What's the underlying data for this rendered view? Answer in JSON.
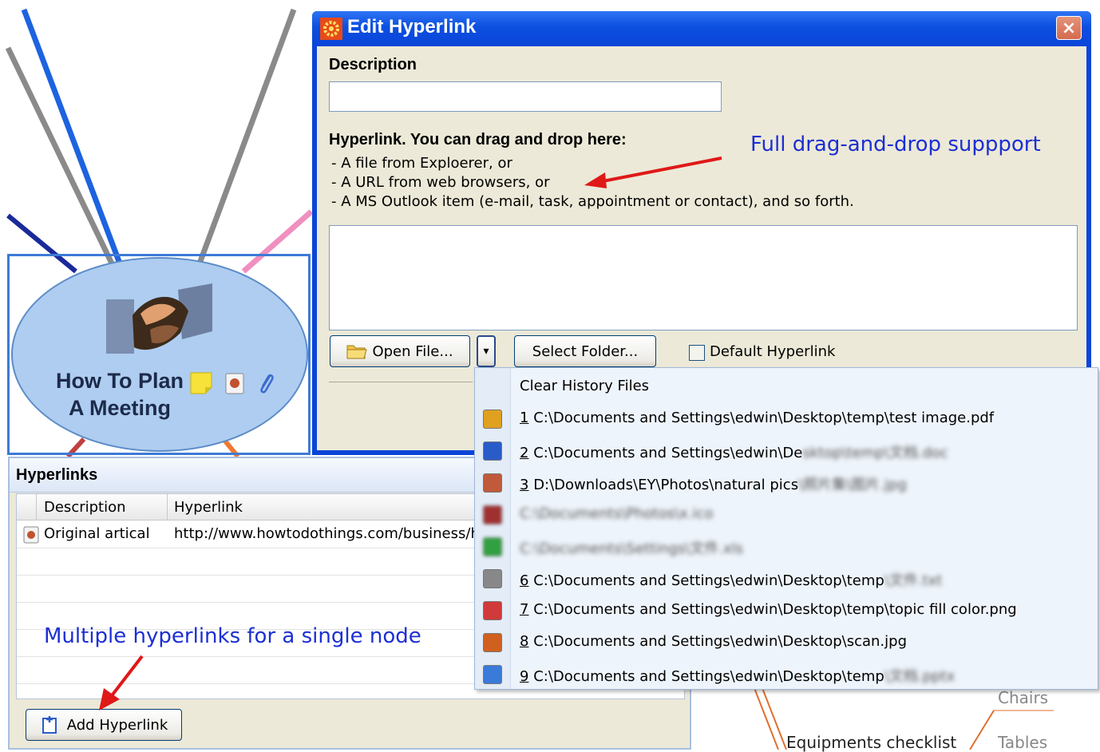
{
  "mindmap": {
    "central_node": {
      "line1": "How To Plan",
      "line2": "A Meeting",
      "icons": [
        "handshake-icon",
        "note-icon",
        "hyperlink-icon",
        "attachment-icon"
      ]
    },
    "branch_labels": [
      "Chairs",
      "Equipments checklist",
      "Tables"
    ]
  },
  "dialog": {
    "title": "Edit Hyperlink",
    "close_glyph": "×",
    "description_label": "Description",
    "description_value": "",
    "hyperlink_label": "Hyperlink. You can drag and drop here:",
    "drop_hints": [
      "- A file from Exploerer, or",
      "- A URL from web browsers, or",
      "- A MS Outlook item (e-mail, task, appointment or contact), and so forth."
    ],
    "hyperlink_value": "",
    "open_file_button": "Open File...",
    "dropdown_glyph": "▾",
    "select_folder_button": "Select Folder...",
    "default_hyperlink_label": "Default Hyperlink",
    "default_hyperlink_checked": false
  },
  "history_menu": {
    "clear_label": "Clear History Files",
    "items": [
      {
        "num": "1",
        "path": "C:\\Documents and Settings\\edwin\\Desktop\\temp\\test image.pdf",
        "hidden": "",
        "icon": "pdf-icon",
        "color": "#e0a020"
      },
      {
        "num": "2",
        "path": "C:\\Documents and Settings\\edwin\\De",
        "hidden": "sktop\\temp\\文档.doc",
        "icon": "word-doc-icon",
        "color": "#2a5cc8"
      },
      {
        "num": "3",
        "path": "D:\\Downloads\\EY\\Photos\\natural pics",
        "hidden": "\\照片集\\图片.jpg",
        "icon": "image-file-icon",
        "color": "#c05a3a"
      },
      {
        "num": "",
        "path": "",
        "hidden": "C:\\Documents\\Photos\\x.ico",
        "icon": "blurred-icon",
        "color": "#a03030"
      },
      {
        "num": "",
        "path": "",
        "hidden": "C:\\Documents\\Settings\\文件.xls",
        "icon": "blurred-icon",
        "color": "#30a040"
      },
      {
        "num": "6",
        "path": "C:\\Documents and Settings\\edwin\\Desktop\\temp",
        "hidden": "\\文件.txt",
        "icon": "text-file-icon",
        "color": "#888888"
      },
      {
        "num": "7",
        "path": "C:\\Documents and Settings\\edwin\\Desktop\\temp\\topic fill color.png",
        "hidden": "",
        "icon": "png-file-icon",
        "color": "#d03a3a"
      },
      {
        "num": "8",
        "path": "C:\\Documents and Settings\\edwin\\Desktop\\scan.jpg",
        "hidden": "",
        "icon": "jpg-file-icon",
        "color": "#d06020"
      },
      {
        "num": "9",
        "path": "C:\\Documents and Settings\\edwin\\Desktop\\temp",
        "hidden": "\\文档.pptx",
        "icon": "globe-file-icon",
        "color": "#3a7ad8"
      }
    ]
  },
  "hyperlinks_panel": {
    "title": "Hyperlinks",
    "columns": [
      "Description",
      "Hyperlink"
    ],
    "rows": [
      {
        "description": "Original artical",
        "hyperlink": "http://www.howtodothings.com/business/h"
      }
    ],
    "add_button": "Add Hyperlink"
  },
  "annotations": {
    "drag_drop": "Full drag-and-drop suppport",
    "multiple": "Multiple hyperlinks for a single node"
  }
}
